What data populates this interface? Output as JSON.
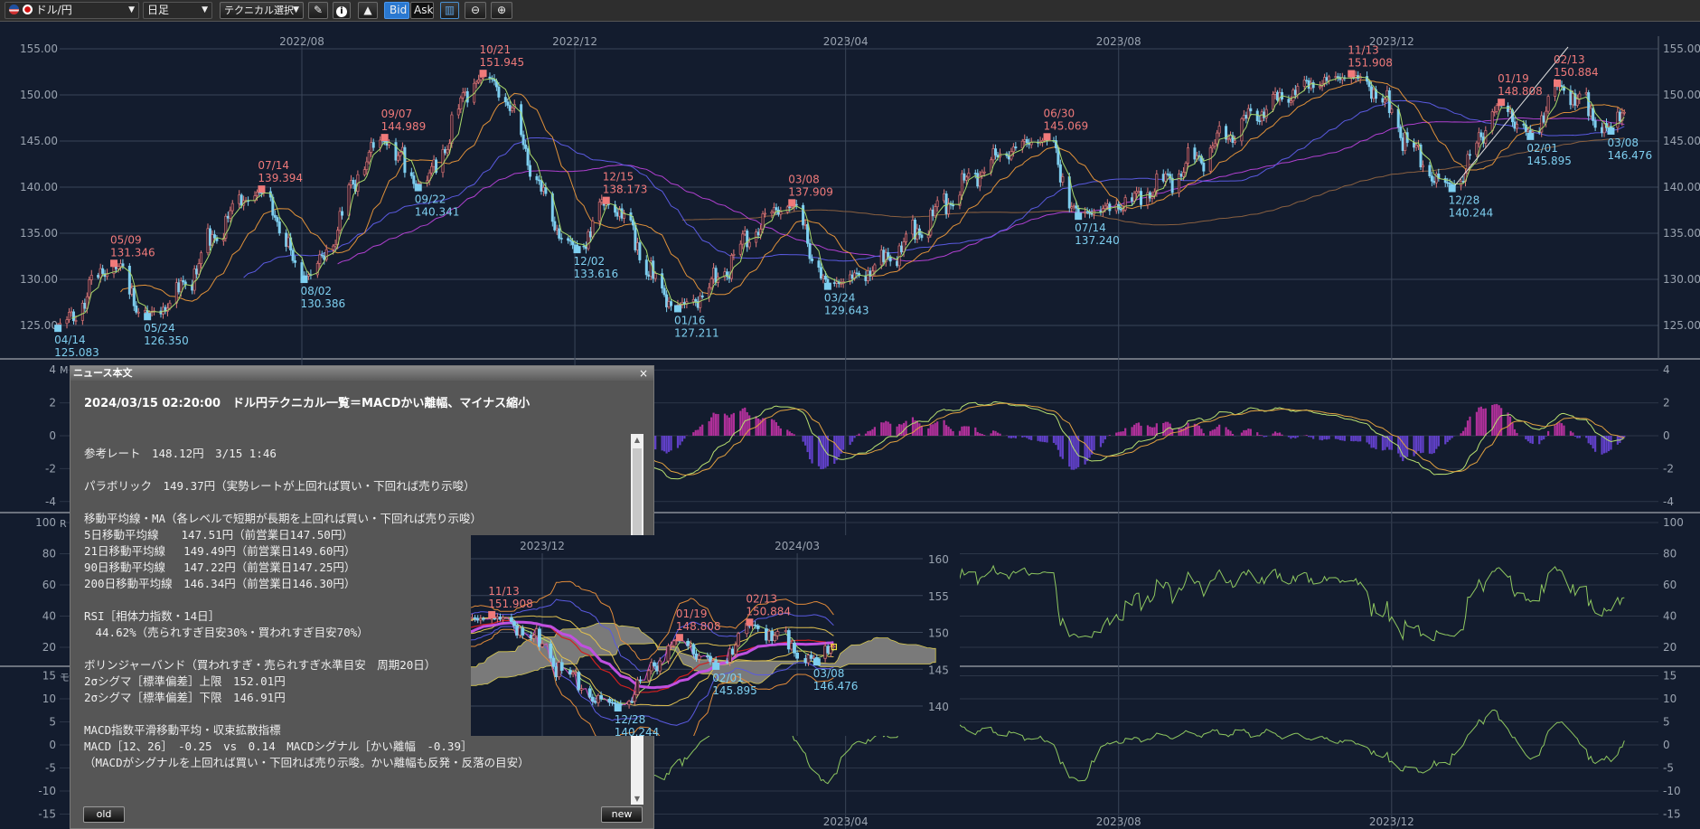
{
  "toolbar": {
    "pair": "ドル/円",
    "timeframe": "日足",
    "technical": "テクニカル選択",
    "bid": "Bid",
    "ask": "Ask"
  },
  "chart": {
    "x_labels": [
      {
        "label": "2022/08",
        "date": "2022-08-01"
      },
      {
        "label": "2022/12",
        "date": "2022-12-01"
      },
      {
        "label": "2023/04",
        "date": "2023-04-01"
      },
      {
        "label": "2023/08",
        "date": "2023-08-01"
      },
      {
        "label": "2023/12",
        "date": "2023-12-01"
      }
    ],
    "bottom_x_labels": [
      {
        "label": "2023/04",
        "date": "2023-04-01"
      },
      {
        "label": "2023/08",
        "date": "2023-08-01"
      },
      {
        "label": "2023/12",
        "date": "2023-12-01"
      }
    ],
    "price_ticks": [
      "155.00",
      "150.00",
      "145.00",
      "140.00",
      "135.00",
      "130.00",
      "125.00"
    ],
    "macd_ticks": [
      "4",
      "2",
      "0",
      "-2",
      "-4"
    ],
    "rsi_ticks": [
      "100",
      "80",
      "60",
      "40",
      "20"
    ],
    "mom_ticks": [
      "15",
      "10",
      "5",
      "0",
      "-5",
      "-10",
      "-15"
    ],
    "panel_labels": {
      "macd": "M",
      "rsi": "R",
      "mom": "モ"
    },
    "last_price": 148.12,
    "pivots": [
      {
        "date": "2022-04-14",
        "label_date": "04/14",
        "label_value": "125.083",
        "type": "low"
      },
      {
        "date": "2022-05-09",
        "label_date": "05/09",
        "label_value": "131.346",
        "type": "high"
      },
      {
        "date": "2022-05-24",
        "label_date": "05/24",
        "label_value": "126.350",
        "type": "low"
      },
      {
        "date": "2022-07-14",
        "label_date": "07/14",
        "label_value": "139.394",
        "type": "high"
      },
      {
        "date": "2022-08-02",
        "label_date": "08/02",
        "label_value": "130.386",
        "type": "low"
      },
      {
        "date": "2022-09-07",
        "label_date": "09/07",
        "label_value": "144.989",
        "type": "high"
      },
      {
        "date": "2022-09-22",
        "label_date": "09/22",
        "label_value": "140.341",
        "type": "low"
      },
      {
        "date": "2022-10-21",
        "label_date": "10/21",
        "label_value": "151.945",
        "type": "high"
      },
      {
        "date": "2022-12-02",
        "label_date": "12/02",
        "label_value": "133.616",
        "type": "low"
      },
      {
        "date": "2022-12-15",
        "label_date": "12/15",
        "label_value": "138.173",
        "type": "high"
      },
      {
        "date": "2023-01-16",
        "label_date": "01/16",
        "label_value": "127.211",
        "type": "low"
      },
      {
        "date": "2023-03-08",
        "label_date": "03/08",
        "label_value": "137.909",
        "type": "high"
      },
      {
        "date": "2023-03-24",
        "label_date": "03/24",
        "label_value": "129.643",
        "type": "low"
      },
      {
        "date": "2023-06-30",
        "label_date": "06/30",
        "label_value": "145.069",
        "type": "high"
      },
      {
        "date": "2023-07-14",
        "label_date": "07/14",
        "label_value": "137.240",
        "type": "low"
      },
      {
        "date": "2023-11-13",
        "label_date": "11/13",
        "label_value": "151.908",
        "type": "high"
      },
      {
        "date": "2023-12-28",
        "label_date": "12/28",
        "label_value": "140.244",
        "type": "low"
      },
      {
        "date": "2024-01-19",
        "label_date": "01/19",
        "label_value": "148.808",
        "type": "high"
      },
      {
        "date": "2024-02-01",
        "label_date": "02/01",
        "label_value": "145.895",
        "type": "low"
      },
      {
        "date": "2024-02-13",
        "label_date": "02/13",
        "label_value": "150.884",
        "type": "high"
      },
      {
        "date": "2024-03-08",
        "label_date": "03/08",
        "label_value": "146.476",
        "type": "low"
      }
    ]
  },
  "mini_chart": {
    "x_labels": [
      {
        "label": "2023/12",
        "date": "2023-12-01"
      },
      {
        "label": "2024/03",
        "date": "2024-03-01"
      }
    ],
    "y_ticks": [
      "160",
      "155",
      "150",
      "145",
      "140"
    ]
  },
  "news": {
    "window_title": "ニュース本文",
    "close": "×",
    "headline": "2024/03/15 02:20:00　ドル円テクニカル一覧＝MACDかい離幅、マイナス縮小",
    "lines": [
      "参考レート　148.12円　3/15 1:46",
      "",
      "パラボリック　149.37円（実勢レートが上回れば買い・下回れば売り示唆）",
      "",
      "移動平均線・MA（各レベルで短期が長期を上回れば買い・下回れば売り示唆）",
      "5日移動平均線　　147.51円（前営業日147.50円）",
      "21日移動平均線　 149.49円（前営業日149.60円）",
      "90日移動平均線　 147.22円（前営業日147.25円）",
      "200日移動平均線　146.34円（前営業日146.30円）",
      "",
      "RSI［相体力指数・14日］",
      "　44.62%（売られすぎ目安30%・買われすぎ目安70%）",
      "",
      "ボリンジャーバンド（買われすぎ・売られすぎ水準目安　周期20日）",
      "2σシグマ［標準偏差］上限　152.01円",
      "2σシグマ［標準偏差］下限　146.91円",
      "",
      "MACD指数平滑移動平均・収束拡散指標",
      "MACD［12、26］　-0.25　vs　0.14　MACDシグナル［かい離幅　-0.39］",
      "（MACDがシグナルを上回れば買い・下回れば売り示唆。かい離幅も反発・反落の目安）"
    ],
    "old_button": "old",
    "new_button": "new"
  }
}
